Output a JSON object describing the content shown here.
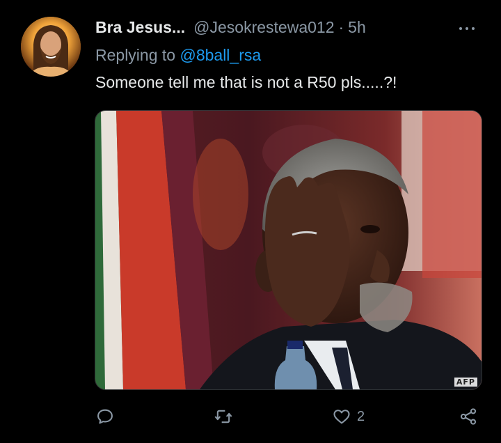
{
  "tweet": {
    "author_name": "Bra Jesus...",
    "author_handle": "@Jesokrestewa012",
    "separator": "·",
    "time": "5h",
    "replying_prefix": "Replying to ",
    "replying_to": "@8ball_rsa",
    "text": "Someone tell me that is not a R50 pls.....?!",
    "media": {
      "watermark": "AFP"
    }
  },
  "actions": {
    "reply_count": "",
    "retweet_count": "",
    "like_count": "2"
  },
  "icons": {
    "more": "more-horizontal-icon",
    "reply": "speech-bubble-icon",
    "retweet": "retweet-arrows-icon",
    "like": "heart-icon",
    "share": "share-nodes-icon"
  },
  "colors": {
    "background": "#000000",
    "primary_text": "#e7e9ea",
    "secondary_text": "#8b98a5",
    "link": "#1d9bf0"
  }
}
